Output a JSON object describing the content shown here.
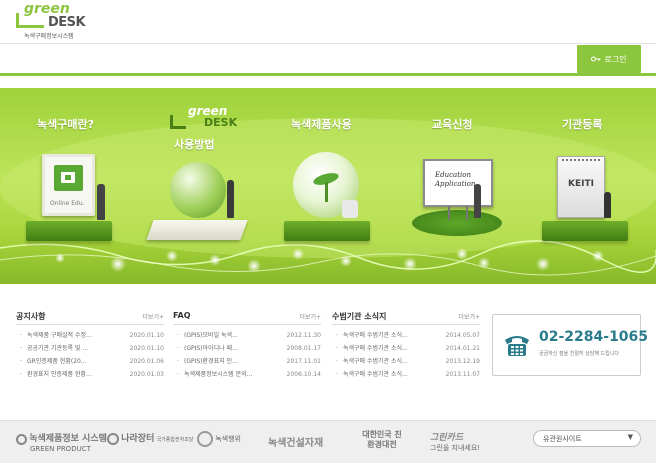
{
  "header": {
    "logo_green": "green",
    "logo_desk": "DESK",
    "logo_sub": "녹색구매정보시스템",
    "login_label": "로그인"
  },
  "banner": {
    "items": [
      {
        "label": "녹색구매란?"
      },
      {
        "label": "사용방법",
        "logo_green": "green",
        "logo_desk": "DESK"
      },
      {
        "label": "녹색제품사용"
      },
      {
        "label": "교육신청",
        "board_text": "Education Application"
      },
      {
        "label": "기관등록",
        "board_text": "KEITI"
      }
    ],
    "screen_text": "Online Edu.",
    "colors": {
      "accent": "#8cc63f",
      "dark_green": "#3f7e12"
    }
  },
  "boards": [
    {
      "title": "공지사항",
      "more": "더보기",
      "rows": [
        {
          "text": "녹색제품 구매실적 수정...",
          "date": "2020.01.10"
        },
        {
          "text": "공공기관 기관등록 및 ...",
          "date": "2020.01.10"
        },
        {
          "text": "GR인증제품 현황(20...",
          "date": "2020.01.06"
        },
        {
          "text": "환경표지 인증제품 현황...",
          "date": "2020.01.03"
        }
      ]
    },
    {
      "title": "FAQ",
      "more": "더보기",
      "rows": [
        {
          "text": "(GPIS)모바일 녹색...",
          "date": "2012.11.30"
        },
        {
          "text": "(GPIS)아이디나 패...",
          "date": "2008.01.17"
        },
        {
          "text": "(GPIS)환경표지 인...",
          "date": "2017.11.01"
        },
        {
          "text": "녹색제품정보시스템 문의...",
          "date": "2006.10.14"
        }
      ]
    },
    {
      "title": "수범기관 소식지",
      "more": "더보기",
      "rows": [
        {
          "text": "녹색구매 수범기관 소식...",
          "date": "2014.05.07"
        },
        {
          "text": "녹색구매 수범기관 소식...",
          "date": "2014.01.21"
        },
        {
          "text": "녹색구매 수범기관 소식...",
          "date": "2013.12.19"
        },
        {
          "text": "녹색구매 수범기관 소식...",
          "date": "2013.11.07"
        }
      ]
    }
  ],
  "contact": {
    "phone": "02-2284-1065",
    "sub": "궁금하신 점을 친절히 상담해 드립니다"
  },
  "footer": {
    "logos": [
      {
        "main": "녹색제품정보 시스템",
        "sub": "GREEN PRODUCT"
      },
      {
        "main": "나라장터",
        "sub": "국가종합전자조달"
      },
      {
        "main": "녹색행위"
      },
      {
        "main": "녹색건설자재"
      },
      {
        "main": "대한민국 친환경대전"
      },
      {
        "main": "그린카드",
        "sub": "그린을 지내세요!"
      }
    ],
    "site_select": "유관원사이트"
  }
}
